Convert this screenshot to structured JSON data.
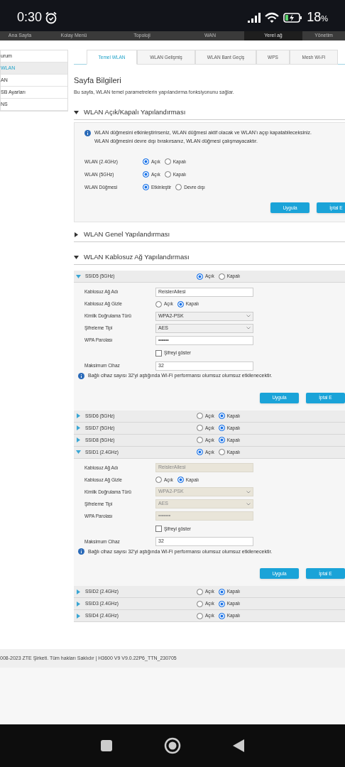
{
  "status_bar": {
    "time": "0:30",
    "battery": "18",
    "battery_unit": "%"
  },
  "top_nav": [
    {
      "label": "Ana Sayfa",
      "selected": false
    },
    {
      "label": "Kolay Menü",
      "selected": false
    },
    {
      "label": "Topoloji",
      "selected": false
    },
    {
      "label": "WAN",
      "selected": false
    },
    {
      "label": "Yerel ağ",
      "selected": true
    },
    {
      "label": "Yönetim",
      "selected": false
    }
  ],
  "sidebar": [
    {
      "label": "urum",
      "selected": false
    },
    {
      "label": "WLAN",
      "selected": true
    },
    {
      "label": "AN",
      "selected": false
    },
    {
      "label": "SB Ayarları",
      "selected": false
    },
    {
      "label": "NS",
      "selected": false
    }
  ],
  "tabs": [
    {
      "label": "Temel WLAN",
      "selected": true
    },
    {
      "label": "WLAN Gelişmiş",
      "selected": false
    },
    {
      "label": "WLAN Bant Geçiş",
      "selected": false
    },
    {
      "label": "WPS",
      "selected": false
    },
    {
      "label": "Mesh Wi-Fi",
      "selected": false
    }
  ],
  "page_info": {
    "title": "Sayfa Bilgileri",
    "description": "Bu sayfa, WLAN temel parametrelerin yapılandırma fonksiyonunu sağlar."
  },
  "wlan_switch": {
    "title": "WLAN Açık/Kapalı Yapılandırması",
    "expanded": true,
    "info": [
      "WLAN düğmesini etkinleştirirseniz, WLAN düğmesi aktif olacak ve WLAN'ı açıp kapatabileceksiniz.",
      "WLAN düğmesini devre dışı bırakırsanız, WLAN düğmesi çalışmayacaktır."
    ],
    "rows": [
      {
        "label": "WLAN (2.4GHz)",
        "options": [
          {
            "label": "Açık",
            "selected": true
          },
          {
            "label": "Kapalı",
            "selected": false
          }
        ]
      },
      {
        "label": "WLAN (5GHz)",
        "options": [
          {
            "label": "Açık",
            "selected": true
          },
          {
            "label": "Kapalı",
            "selected": false
          }
        ]
      },
      {
        "label": "WLAN Düğmesi",
        "options": [
          {
            "label": "Etkinleştir",
            "selected": true
          },
          {
            "label": "Devre dışı",
            "selected": false
          }
        ]
      }
    ],
    "buttons": [
      "Uygula",
      "İptal E"
    ]
  },
  "general": {
    "title": "WLAN Genel Yapılandırması",
    "expanded": false
  },
  "wireless": {
    "title": "WLAN Kablosuz Ağ Yapılandırması",
    "expanded": true,
    "ssids": [
      {
        "name": "SSID5 (5GHz)",
        "expanded": true,
        "options": [
          {
            "label": "Açık",
            "selected": true
          },
          {
            "label": "Kapalı",
            "selected": false
          }
        ],
        "fields": [
          {
            "kind": "text",
            "label": "Kablosuz Ağ Adı",
            "value": "ReislerAilesi",
            "disabled": false
          },
          {
            "kind": "radio",
            "label": "Kablosuz Ağ Gizle",
            "options": [
              {
                "label": "Açık",
                "selected": false
              },
              {
                "label": "Kapalı",
                "selected": true
              }
            ]
          },
          {
            "kind": "select",
            "label": "Kimlik Doğrulama Türü",
            "value": "WPA2-PSK",
            "disabled": false
          },
          {
            "kind": "select",
            "label": "Şifreleme Tipi",
            "value": "AES",
            "disabled": false
          },
          {
            "kind": "text",
            "label": "WPA Parolası",
            "value": "••••••",
            "disabled": false
          },
          {
            "kind": "checkbox",
            "label": "Şifreyi göster",
            "checked": false
          },
          {
            "kind": "text",
            "label": "Maksimum Cihaz",
            "value": "32",
            "disabled": false
          }
        ],
        "note": "Bağlı cihaz sayısı 32'yi aştığında Wi-Fi performansı olumsuz olumsuz etkilenecektir.",
        "buttons": [
          "Uygula",
          "İptal E"
        ]
      },
      {
        "name": "SSID6 (5GHz)",
        "expanded": false,
        "options": [
          {
            "label": "Açık",
            "selected": false
          },
          {
            "label": "Kapalı",
            "selected": true
          }
        ]
      },
      {
        "name": "SSID7 (5GHz)",
        "expanded": false,
        "options": [
          {
            "label": "Açık",
            "selected": false
          },
          {
            "label": "Kapalı",
            "selected": true
          }
        ]
      },
      {
        "name": "SSID8 (5GHz)",
        "expanded": false,
        "options": [
          {
            "label": "Açık",
            "selected": false
          },
          {
            "label": "Kapalı",
            "selected": true
          }
        ]
      },
      {
        "name": "SSID1 (2.4GHz)",
        "expanded": true,
        "options": [
          {
            "label": "Açık",
            "selected": true
          },
          {
            "label": "Kapalı",
            "selected": false
          }
        ],
        "fields": [
          {
            "kind": "text",
            "label": "Kablosuz Ağ Adı",
            "value": "ReislerAilesi",
            "disabled": true
          },
          {
            "kind": "radio",
            "label": "Kablosuz Ağ Gizle",
            "options": [
              {
                "label": "Açık",
                "selected": false
              },
              {
                "label": "Kapalı",
                "selected": true
              }
            ]
          },
          {
            "kind": "select",
            "label": "Kimlik Doğrulama Türü",
            "value": "WPA2-PSK",
            "disabled": true
          },
          {
            "kind": "select",
            "label": "Şifreleme Tipi",
            "value": "AES",
            "disabled": true
          },
          {
            "kind": "text",
            "label": "WPA Parolası",
            "value": "•••••••",
            "disabled": true
          },
          {
            "kind": "checkbox",
            "label": "Şifreyi göster",
            "checked": false
          },
          {
            "kind": "text",
            "label": "Maksimum Cihaz",
            "value": "32",
            "disabled": false
          }
        ],
        "note": "Bağlı cihaz sayısı 32'yi aştığında Wi-Fi performansı olumsuz olumsuz etkilenecektir.",
        "buttons": [
          "Uygula",
          "İptal E"
        ]
      },
      {
        "name": "SSID2 (2.4GHz)",
        "expanded": false,
        "options": [
          {
            "label": "Açık",
            "selected": false
          },
          {
            "label": "Kapalı",
            "selected": true
          }
        ]
      },
      {
        "name": "SSID3 (2.4GHz)",
        "expanded": false,
        "options": [
          {
            "label": "Açık",
            "selected": false
          },
          {
            "label": "Kapalı",
            "selected": true
          }
        ]
      },
      {
        "name": "SSID4 (2.4GHz)",
        "expanded": false,
        "options": [
          {
            "label": "Açık",
            "selected": false
          },
          {
            "label": "Kapalı",
            "selected": true
          }
        ]
      }
    ]
  },
  "footer": "008-2023 ZTE Şirketi. Tüm hakları Saklıdır  |  H3600 V9 V9.0.22P6_TTN_230705"
}
